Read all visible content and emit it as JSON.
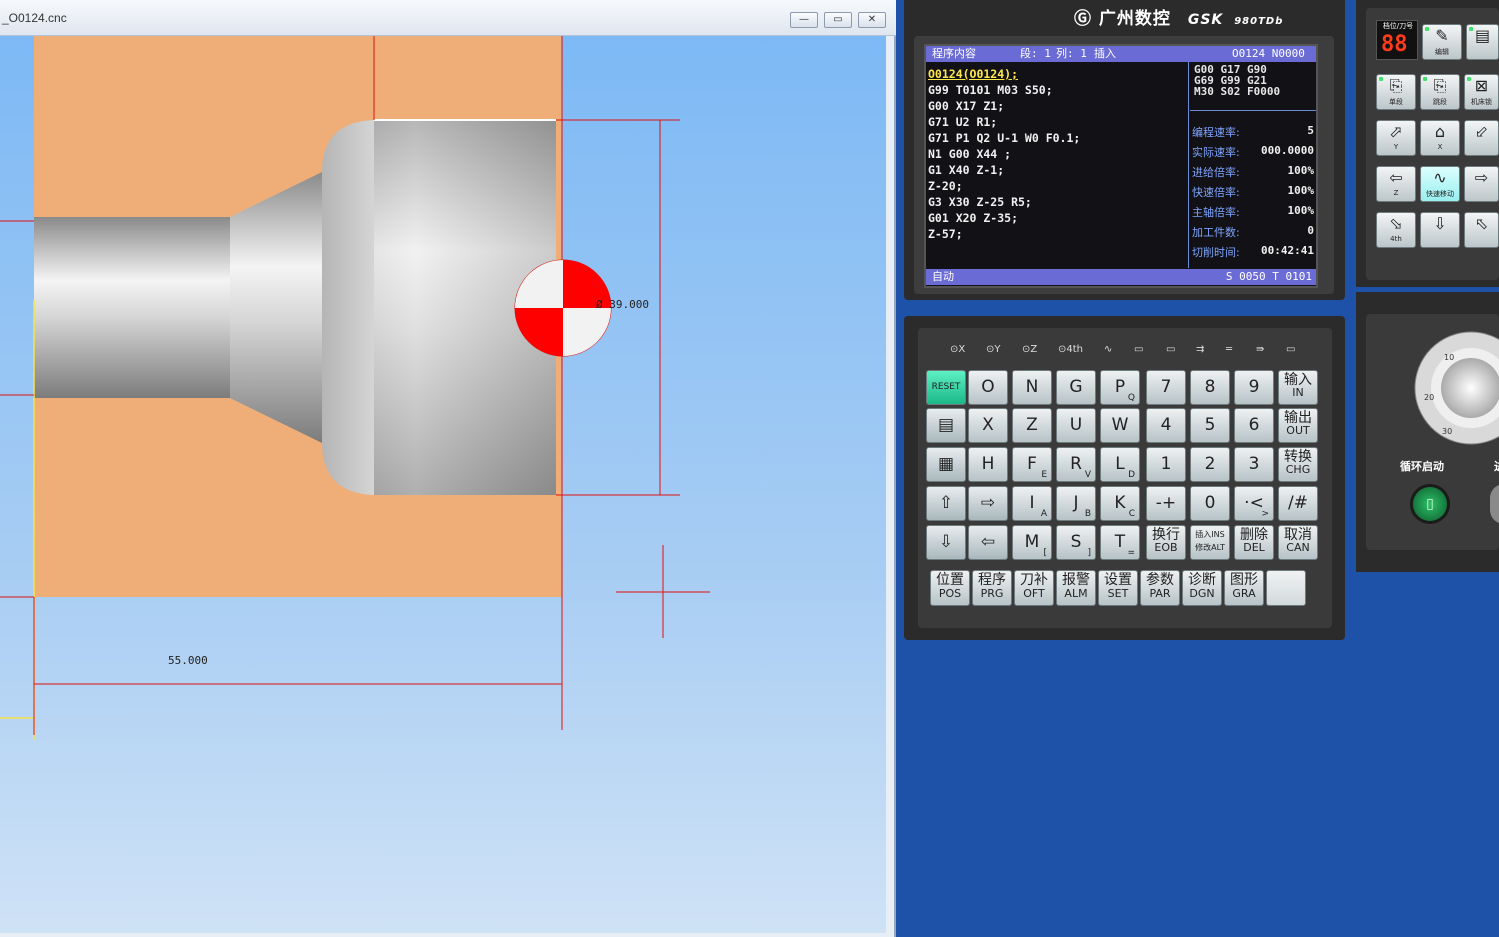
{
  "window": {
    "title": "_O0124.cnc",
    "min": "▭",
    "max": "▭",
    "close": "✕"
  },
  "drawing": {
    "dim_length": "55.000",
    "dim_diameter": "Ø  39.000"
  },
  "controller": {
    "brand_cn": "广州数控",
    "brand_gsk": "GSK",
    "model": "980TDb"
  },
  "lcd": {
    "header_mode": "程序内容",
    "header_seg": "段: 1",
    "header_col": "列: 1",
    "header_edit": "插入",
    "header_prog": "O0124  N0000",
    "program_lines": [
      "O0124(O0124);",
      "G99 T0101 M03 S50;",
      "G00 X17 Z1;",
      "G71 U2 R1;",
      "G71 P1 Q2 U-1 W0 F0.1;",
      "N1 G00 X44 ;",
      "G1 X40 Z-1;",
      "Z-20;",
      "G3 X30 Z-25 R5;",
      "G01 X20 Z-35;",
      "Z-57;"
    ],
    "modal_lines": [
      "G00 G17 G90",
      "G69 G99 G21",
      "M30 S02 F0000"
    ],
    "stats": [
      {
        "k": "编程速率:",
        "v": "5"
      },
      {
        "k": "实际速率:",
        "v": "000.0000"
      },
      {
        "k": "进给倍率:",
        "v": "100%"
      },
      {
        "k": "快速倍率:",
        "v": "100%"
      },
      {
        "k": "主轴倍率:",
        "v": "100%"
      },
      {
        "k": "加工件数:",
        "v": "0"
      },
      {
        "k": "切削时间:",
        "v": "00:42:41"
      }
    ],
    "footer_mode": "自动",
    "footer_right": "S 0050  T 0101"
  },
  "axis_labels": [
    "X",
    "Y",
    "Z",
    "4th",
    "",
    "",
    "",
    "",
    "",
    "",
    ""
  ],
  "keys": {
    "row1": [
      "RESET",
      "O",
      "N",
      "G",
      "P",
      "7",
      "8",
      "9"
    ],
    "row1_subs": [
      "",
      "",
      "",
      "",
      "Q",
      "",
      "",
      ""
    ],
    "row2": [
      "",
      "X",
      "Z",
      "U",
      "W",
      "4",
      "5",
      "6"
    ],
    "row3": [
      "",
      "H",
      "F",
      "R",
      "L",
      "1",
      "2",
      "3"
    ],
    "row3_subs": [
      "",
      "",
      "E",
      "V",
      "D",
      "",
      "",
      ""
    ],
    "row4": [
      "⇧",
      "⇨",
      "I",
      "J",
      "K",
      "-+",
      "0",
      "·<"
    ],
    "row4_subs": [
      "",
      "",
      "A",
      "B",
      "C",
      "",
      "",
      ">"
    ],
    "row5": [
      "⇩",
      "⇦",
      "M",
      "S",
      "T"
    ],
    "row5_subs": [
      "",
      "",
      "[",
      "]",
      "="
    ],
    "in": {
      "cn": "输入",
      "en": "IN"
    },
    "out": {
      "cn": "输出",
      "en": "OUT"
    },
    "chg": {
      "cn": "转换",
      "en": "CHG"
    },
    "slash": "/#",
    "eob": {
      "cn": "换行",
      "en": "EOB"
    },
    "ins": {
      "cn": "插入INS",
      "en": "修改ALT"
    },
    "del": {
      "cn": "删除",
      "en": "DEL"
    },
    "can": {
      "cn": "取消",
      "en": "CAN"
    }
  },
  "fkeys": [
    {
      "cn": "位置",
      "en": "POS"
    },
    {
      "cn": "程序",
      "en": "PRG"
    },
    {
      "cn": "刀补",
      "en": "OFT"
    },
    {
      "cn": "报警",
      "en": "ALM"
    },
    {
      "cn": "设置",
      "en": "SET"
    },
    {
      "cn": "参数",
      "en": "PAR"
    },
    {
      "cn": "诊断",
      "en": "DGN"
    },
    {
      "cn": "图形",
      "en": "GRA"
    }
  ],
  "oppanel": {
    "tool_label": "档位/刀号",
    "tool_value": "88",
    "labels": [
      "编辑",
      "单段",
      "跳段",
      "机床锁",
      "快速移动"
    ],
    "cycle_start": "循环启动",
    "feed_hold": "进"
  },
  "colors": {
    "lcd_bar": "#6b6bd6",
    "stock": "#efae78",
    "dim_line": "#e01010",
    "reset": "#2fd6a0"
  }
}
